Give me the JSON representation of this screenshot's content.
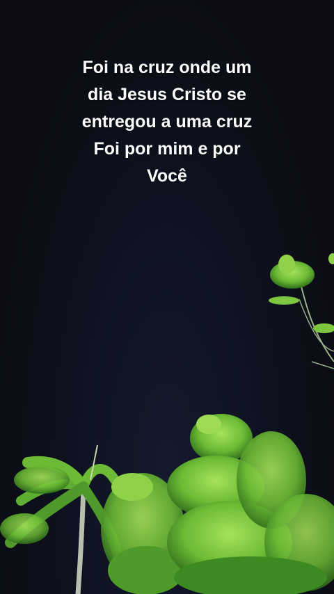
{
  "caption": {
    "lines": [
      "Foi na cruz onde um",
      "dia Jesus Cristo se",
      "entregou a uma cruz",
      "Foi por mim e por",
      "Você"
    ]
  },
  "colors": {
    "sky": "#0d0e15",
    "foliage_light": "#8fd24a",
    "foliage_dark": "#3e8a22",
    "text": "#ffffff"
  }
}
